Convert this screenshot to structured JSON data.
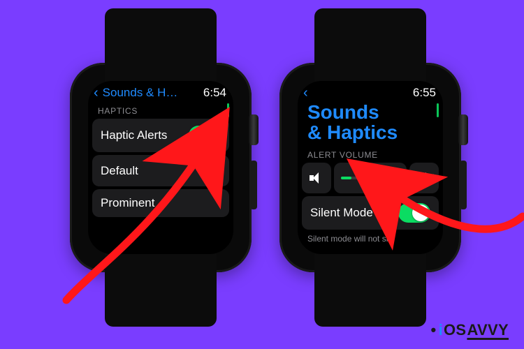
{
  "left_watch": {
    "back_label": "Sounds & H…",
    "time": "6:54",
    "section_label": "HAPTICS",
    "haptic_alerts_label": "Haptic Alerts",
    "haptic_alerts_on": true,
    "option_default": "Default",
    "option_prominent": "Prominent",
    "selected_option": "Default"
  },
  "right_watch": {
    "time": "6:55",
    "title_line1": "Sounds",
    "title_line2": "& Haptics",
    "section_label": "ALERT VOLUME",
    "volume_percent": 18,
    "silent_mode_label": "Silent Mode",
    "silent_mode_on": true,
    "hint_truncated": "Silent mode will not si-"
  },
  "brand": {
    "i": "i",
    "os": "OS",
    "rest": "AVVY"
  },
  "colors": {
    "bg": "#7a3dff",
    "accent_blue": "#1f8bff",
    "accent_green": "#0bdc62",
    "arrow": "#ff171a"
  }
}
